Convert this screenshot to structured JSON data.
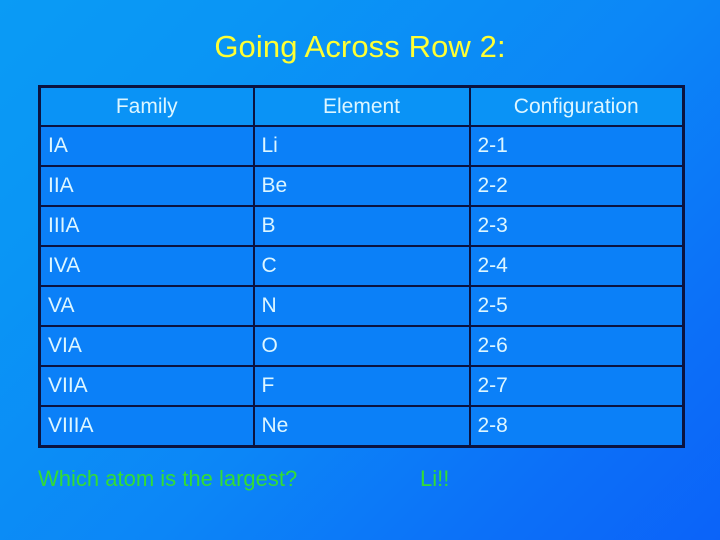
{
  "slide": {
    "title": "Going Across Row 2:",
    "title_color": "#ffff33",
    "background_from": "#0a9bf5",
    "background_to": "#0b63f9"
  },
  "table": {
    "border_color": "#0b1340",
    "header_bg": "#0a93f6",
    "cell_bg": "#0b80f8",
    "text_color": "#ddf6ff",
    "headers": [
      "Family",
      "Element",
      "Configuration"
    ],
    "rows": [
      {
        "family": "IA",
        "element": "Li",
        "configuration": "2-1"
      },
      {
        "family": "IIA",
        "element": "Be",
        "configuration": "2-2"
      },
      {
        "family": "IIIA",
        "element": "B",
        "configuration": "2-3"
      },
      {
        "family": "IVA",
        "element": "C",
        "configuration": "2-4"
      },
      {
        "family": "VA",
        "element": "N",
        "configuration": "2-5"
      },
      {
        "family": "VIA",
        "element": "O",
        "configuration": "2-6"
      },
      {
        "family": "VIIA",
        "element": "F",
        "configuration": "2-7"
      },
      {
        "family": "VIIIA",
        "element": "Ne",
        "configuration": "2-8"
      }
    ]
  },
  "footer": {
    "question": "Which atom is the largest?",
    "answer": "Li!!",
    "color": "#33dd33"
  }
}
